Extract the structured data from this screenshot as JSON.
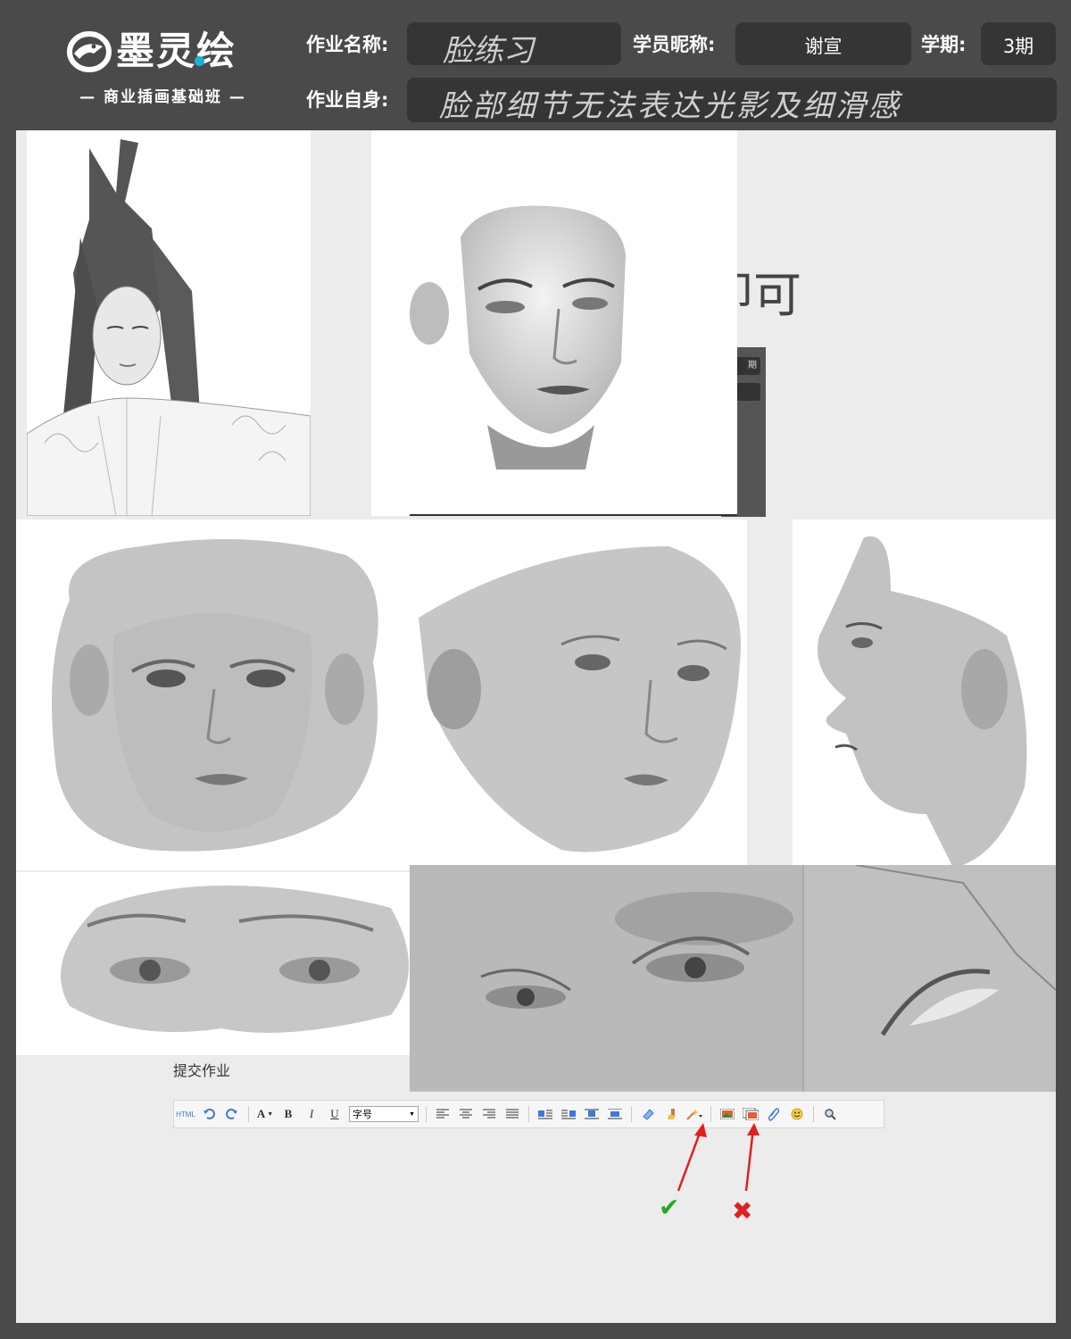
{
  "header": {
    "logo_text": "墨灵绘",
    "logo_subtitle": "— 商业插画基础班 —",
    "assignment_name_label": "作业名称:",
    "assignment_name_value": "脸练习",
    "student_nickname_label": "学员昵称:",
    "student_nickname_value": "谢宣",
    "term_label": "学期:",
    "term_value": "3期",
    "self_assessment_label": "作业自身:",
    "self_assessment_value": "脸部细节无法表达光影及细滑感"
  },
  "background_overlay_text": "即可",
  "background_tab_text": "期",
  "editor": {
    "submit_title": "提交作业",
    "html_button": "HTML",
    "font_size_select": "字号",
    "bold": "B",
    "italic": "I",
    "underline": "U",
    "font_color": "A"
  },
  "annotations": {
    "correct_mark": "✔",
    "wrong_mark": "✖"
  },
  "colors": {
    "header_bg": "#4a4a4a",
    "canvas_bg": "#ececec",
    "arrow_red": "#e02020",
    "check_green": "#22aa22",
    "logo_dot": "#19b3d9"
  }
}
